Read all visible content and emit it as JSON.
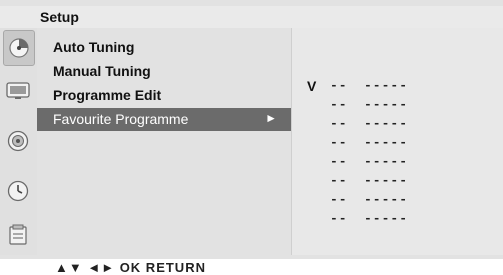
{
  "header": {
    "title": "Setup"
  },
  "sidebar": {
    "icons": [
      "setup-icon",
      "tv-picture-icon",
      "audio-icon",
      "time-icon",
      "option-icon"
    ]
  },
  "menu": {
    "items": [
      {
        "label": "Auto Tuning"
      },
      {
        "label": "Manual Tuning"
      },
      {
        "label": "Programme Edit"
      },
      {
        "label": "Favourite Programme",
        "selected": true,
        "arrow": "►"
      }
    ]
  },
  "favourite": {
    "v_label": "V",
    "rows": [
      {
        "num": "--",
        "name": "-----"
      },
      {
        "num": "--",
        "name": "-----"
      },
      {
        "num": "--",
        "name": "-----"
      },
      {
        "num": "--",
        "name": "-----"
      },
      {
        "num": "--",
        "name": "-----"
      },
      {
        "num": "--",
        "name": "-----"
      },
      {
        "num": "--",
        "name": "-----"
      },
      {
        "num": "--",
        "name": "-----"
      }
    ]
  },
  "footer": {
    "nav_hint": "▲▼  ◄►  OK  RETURN"
  },
  "colors": {
    "selected_bg": "#6b6b6b",
    "panel_bg": "#e2e2e2"
  }
}
